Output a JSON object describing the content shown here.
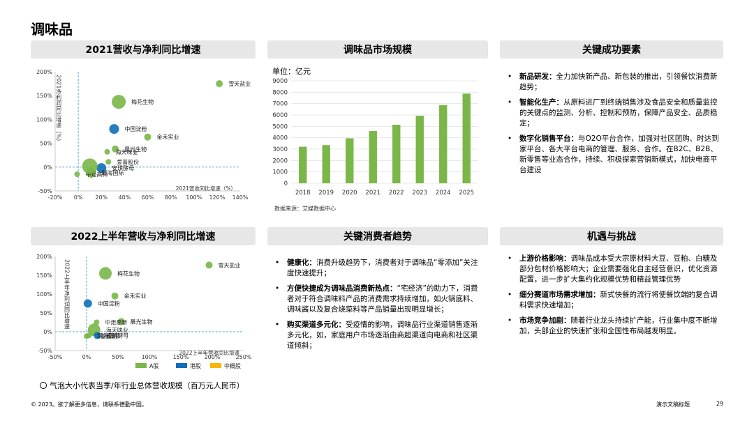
{
  "page_title": "调味品",
  "headers": {
    "p1": "2021营收与净利同比增速",
    "p2": "调味品市场规模",
    "p3": "关键成功要素",
    "p4": "2022上半年营收与净利同比增速",
    "p5": "关键消费者趋势",
    "p6": "机遇与挑战"
  },
  "colors": {
    "a_share": "#7ab648",
    "hk_share": "#0e6fb8",
    "cn_adr": "#f5b800",
    "bar": "#7ab648",
    "header_bg": "#e7e7e7",
    "dash": "#5aa6d6"
  },
  "bubble_note": "气泡大小代表当季/年行业总体营收规模（百万元人民币）",
  "source": "数据来源：艾媒数据中心",
  "footer": {
    "left": "© 2023。欲了解更多信息，请联系德勤中国。",
    "right": "演示文稿标题",
    "page": "29"
  },
  "p3_items": [
    {
      "head": "新品研发：",
      "text": "全力加快新产品、新包装的推出，引领餐饮消费新趋势；"
    },
    {
      "head": "智能化生产：",
      "text": "从原料进厂到终端销售涉及食品安全和质量监控的关键点的监测、分析、控制和预防，保障产品安全、品质稳定；"
    },
    {
      "head": "数字化销售平台：",
      "text": "与O2O平台合作，加强对社区团购、时达到家平台、各大平台电商的管理、服务、合作。在B2C、B2B、新零售等业态合作，持续、积极探索营销新模式，加快电商平台建设"
    }
  ],
  "p5_items": [
    {
      "head": "健康化：",
      "text": "消费升级趋势下，消费者对于调味品“零添加”关注度快速提升；"
    },
    {
      "head": "方便快捷成为调味品消费新热点：",
      "text": "“宅经济”的助力下，消费者对于符合调味料产品的消费需求持续增加，如火锅底料、调味酱以及复合烧菜料等产品销量出现明显增长；"
    },
    {
      "head": "购买渠道多元化：",
      "text": "受疫情的影响，调味品行业渠道销售逐渐多元化，如，家庭用户市场逐渐由商超渠道向电商和社区渠道倾斜；"
    }
  ],
  "p6_items": [
    {
      "head": "上游价格影响：",
      "text": "调味品成本受大宗原材料大豆、豆粕、白糖及部分包材价格影响大；企业需要强化自主经营意识，优化资源配置，进一步扩大集约化规模优势和精益管理优势"
    },
    {
      "head": "细分赛道市场需求增加：",
      "text": "新式快餐的流行将使餐饮端的复合调料需求快速增加；"
    },
    {
      "head": "市场竞争加剧：",
      "text": "随着行业龙头持续扩产能，行业集中度不断增加，头部企业的快速扩张和全国性布局越发明显。"
    }
  ],
  "chart_data": [
    {
      "type": "scatter",
      "title": "2021营收与净利同比增速",
      "xlabel": "2021营收同比增速（%）",
      "ylabel": "2021净利润同比增速（%）",
      "xlim": [
        -20,
        140
      ],
      "ylim": [
        -50,
        200
      ],
      "xticks": [
        "-20%",
        "0%",
        "20%",
        "40%",
        "60%",
        "80%",
        "100%",
        "120%",
        "140%"
      ],
      "yticks": [
        "-50%",
        "0%",
        "50%",
        "100%",
        "150%",
        "200%"
      ],
      "xtick_values": [
        -20,
        0,
        20,
        40,
        60,
        80,
        100,
        120,
        140
      ],
      "ytick_values": [
        -50,
        0,
        50,
        100,
        150,
        200
      ],
      "points": [
        {
          "name": "雪天盐业",
          "x": 122,
          "y": 175,
          "size": 5,
          "group": "A"
        },
        {
          "name": "梅花生物",
          "x": 35,
          "y": 137,
          "size": 10,
          "group": "A"
        },
        {
          "name": "中国淀粉",
          "x": 31,
          "y": 80,
          "size": 7,
          "group": "H"
        },
        {
          "name": "金禾实业",
          "x": 60,
          "y": 63,
          "size": 5,
          "group": "A"
        },
        {
          "name": "晨光生物",
          "x": 32,
          "y": 38,
          "size": 5,
          "group": "A"
        },
        {
          "name": "海天味业",
          "x": 25,
          "y": 32,
          "size": 4,
          "group": "A"
        },
        {
          "name": "爱普股份",
          "x": 26,
          "y": 11,
          "size": 4,
          "group": "A"
        },
        {
          "name": "安琪酵母",
          "x": 20,
          "y": -2,
          "size": 7,
          "group": "H"
        },
        {
          "name": "颐海国际",
          "x": 11,
          "y": -12,
          "size": 7,
          "group": "A"
        },
        {
          "name": "中炬高新",
          "x": -1,
          "y": -15,
          "size": 4,
          "group": "A"
        },
        {
          "name": "",
          "x": 10,
          "y": 2,
          "size": 11,
          "group": "A"
        }
      ]
    },
    {
      "type": "bar",
      "title": "调味品市场规模",
      "unit": "单位：亿元",
      "categories": [
        "2018",
        "2019",
        "2020",
        "2021",
        "2022",
        "2023",
        "2024",
        "2025"
      ],
      "values": [
        3210,
        3350,
        3950,
        4590,
        5140,
        5930,
        6860,
        7880
      ],
      "ylim": [
        0,
        9000
      ],
      "yticks": [
        "0",
        "1000",
        "2000",
        "3000",
        "4000",
        "5000",
        "6000",
        "7000",
        "8000",
        "9000"
      ],
      "ytick_values": [
        0,
        1000,
        2000,
        3000,
        4000,
        5000,
        6000,
        7000,
        8000,
        9000
      ]
    },
    {
      "type": "scatter",
      "title": "2022上半年营收与净利同比增速",
      "xlabel": "2022上半年营收同比增速",
      "ylabel": "2022上半年净利润同比增速",
      "xlim": [
        -50,
        250
      ],
      "ylim": [
        -50,
        200
      ],
      "xticks": [
        "-50%",
        "0%",
        "50%",
        "100%",
        "150%",
        "200%",
        "250%"
      ],
      "yticks": [
        "-50%",
        "0%",
        "50%",
        "100%",
        "150%",
        "200%"
      ],
      "xtick_values": [
        -50,
        0,
        50,
        100,
        150,
        200,
        250
      ],
      "ytick_values": [
        -50,
        0,
        50,
        100,
        150,
        200
      ],
      "legend": [
        "A股",
        "港股",
        "中概股"
      ],
      "points": [
        {
          "name": "雪天盐业",
          "x": 195,
          "y": 177,
          "size": 5,
          "group": "A"
        },
        {
          "name": "梅花生物",
          "x": 30,
          "y": 155,
          "size": 9,
          "group": "A"
        },
        {
          "name": "中国淀粉",
          "x": 2,
          "y": 75,
          "size": 6,
          "group": "H"
        },
        {
          "name": "金禾实业",
          "x": 45,
          "y": 95,
          "size": 5,
          "group": "A"
        },
        {
          "name": "晨光生物",
          "x": 55,
          "y": 27,
          "size": 5,
          "group": "A"
        },
        {
          "name": "海天味业",
          "x": 12,
          "y": 5,
          "size": 9,
          "group": "A"
        },
        {
          "name": "中炬高新",
          "x": 16,
          "y": 25,
          "size": 4,
          "group": "A"
        },
        {
          "name": "爱普股份",
          "x": 0,
          "y": -12,
          "size": 4,
          "group": "A"
        },
        {
          "name": "安琪酵母",
          "x": 17,
          "y": -10,
          "size": 5,
          "group": "H"
        },
        {
          "name": "颐海国际",
          "x": 4,
          "y": -10,
          "size": 4,
          "group": "A"
        }
      ]
    }
  ]
}
